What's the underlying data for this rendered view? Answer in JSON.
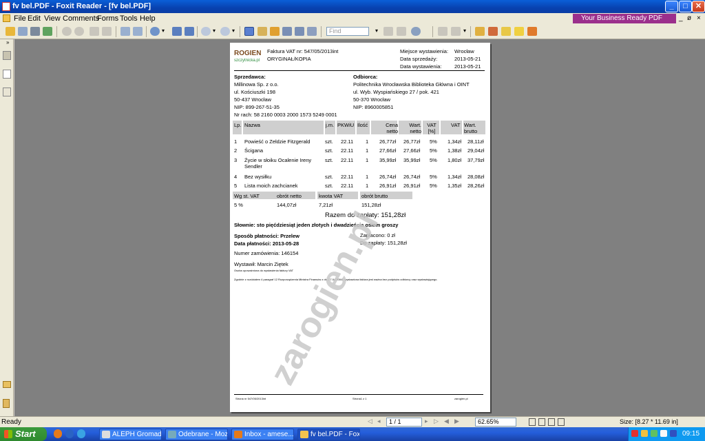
{
  "window": {
    "title": "fv bel.PDF - Foxit Reader - [fv bel.PDF]",
    "controls": [
      "_",
      "□",
      "✕"
    ]
  },
  "menu": [
    "File",
    "Edit",
    "View",
    "Comments",
    "Forms",
    "Tools",
    "Help"
  ],
  "ad": "Your Business Ready PDF solution",
  "mdi": [
    "_",
    "ø",
    "×"
  ],
  "toolbar": {
    "find_placeholder": "Find"
  },
  "invoice": {
    "logo_top": "ROGIEN",
    "logo_bottom": "szczytnicka.pl",
    "number": "Faktura VAT nr: 547/05/2013int",
    "copy": "ORYGINAŁ/KOPIA",
    "meta": [
      [
        "Miejsce wystawienia:",
        "Wrocław"
      ],
      [
        "Data sprzedaży:",
        "2013-05-21"
      ],
      [
        "Data wystawienia:",
        "2013-05-21"
      ]
    ],
    "seller_label": "Sprzedawca:",
    "seller": [
      "Millinowa Sp. z o.o.",
      "ul. Kościuszki 198",
      "50-437 Wrocław",
      "NIP: 899-267-51-35",
      "Nr rach: 58 2160 0003 2000 1573 5249 0001"
    ],
    "buyer_label": "Odbiorca:",
    "buyer": [
      "Politechnika Wrocławska Biblioteka Główna i OINT",
      "ul. Wyb. Wyspiańskiego 27 / pok. 421",
      "50-370 Wrocław",
      "NIP: 8960005851"
    ],
    "columns": [
      "Lp.",
      "Nazwa",
      "j.m.",
      "PKWiU",
      "Ilość",
      "Cena netto",
      "Wart. netto",
      "VAT [%]",
      "VAT",
      "Wart. brutto"
    ],
    "rows": [
      [
        "1",
        "Powieść o Zeldzie Fitzgerald",
        "szt.",
        "22.11",
        "1",
        "26,77zł",
        "26,77zł",
        "5%",
        "1,34zł",
        "28,11zł"
      ],
      [
        "2",
        "Ścigana",
        "szt.",
        "22.11",
        "1",
        "27,66zł",
        "27,66zł",
        "5%",
        "1,38zł",
        "29,04zł"
      ],
      [
        "3",
        "Życie w słoiku Ocalenie Ireny Sendler",
        "szt.",
        "22.11",
        "1",
        "35,99zł",
        "35,99zł",
        "5%",
        "1,80zł",
        "37,79zł"
      ],
      [
        "4",
        "Bez wysiłku",
        "szt.",
        "22.11",
        "1",
        "26,74zł",
        "26,74zł",
        "5%",
        "1,34zł",
        "28,08zł"
      ],
      [
        "5",
        "Lista moich zachcianek",
        "szt.",
        "22.11",
        "1",
        "26,91zł",
        "26,91zł",
        "5%",
        "1,35zł",
        "28,26zł"
      ]
    ],
    "summary_headers": [
      "Wg st. VAT",
      "obrót netto",
      "kwota VAT",
      "obrót brutto"
    ],
    "summary_values": [
      "5 %",
      "144,07zł",
      "7,21zł",
      "151,28zł"
    ],
    "total": "Razem do zapłaty: 151,28zł",
    "words": "Słownie: sto pięćdziesiąt jeden złotych i dwadzieścia osiem groszy",
    "payment_method": "Sposób płatności: Przelew",
    "payment_date": "Data płatności: 2013-05-28",
    "paid": "Zapłacono: 0 zł",
    "to_pay": "Do zapłaty: 151,28zł",
    "order": "Numer zamówienia: 146154",
    "issued_by": "Wystawił: Marcin Ziętek",
    "note1": "Osoba upoważniona do wystawienia faktury VAT",
    "note2": "Zgodnie z rozdziałem 4 paragraf 12 Rozporządzenia Ministra Finansów z dn. 27.04.2004r. wystawiona faktura jest ważna bez podpisów odbiorcy oraz wystawiającego.",
    "footer": [
      "Strona nr 547/05/2013int",
      "Strona1 z 1",
      "zarogien.pl"
    ]
  },
  "watermark": "zarogien.pl",
  "status": {
    "left": "Ready",
    "page": "1 / 1",
    "zoom": "62.65%",
    "size": "Size: [8.27 * 11.69 in]"
  },
  "taskbar": {
    "start": "Start",
    "tasks": [
      "ALEPH Gromadz...",
      "Odebrane - Mozi...",
      "Inbox - amese...",
      "fv bel.PDF - Foxi..."
    ],
    "clock": "09:15"
  }
}
